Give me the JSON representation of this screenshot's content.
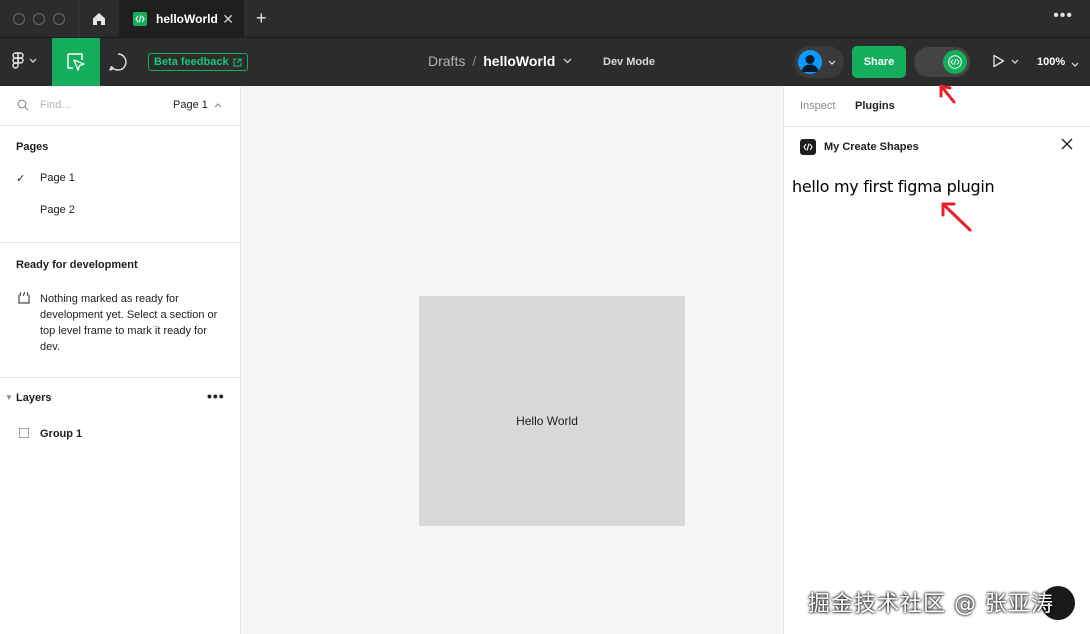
{
  "titlebar": {
    "tab_title": "helloWorld",
    "close_glyph": "✕",
    "new_tab_glyph": "+",
    "more_glyph": "•••"
  },
  "toolbar": {
    "beta_feedback": "Beta feedback",
    "breadcrumb_parent": "Drafts",
    "breadcrumb_sep": "/",
    "file_name": "helloWorld",
    "dev_mode_label": "Dev Mode",
    "share_label": "Share",
    "zoom": "100%",
    "caret": "⌄"
  },
  "left_panel": {
    "find_placeholder": "Find...",
    "current_page": "Page 1",
    "pages_title": "Pages",
    "pages": [
      {
        "label": "Page 1",
        "selected": true,
        "check": "✓"
      },
      {
        "label": "Page 2",
        "selected": false,
        "check": ""
      }
    ],
    "ready_title": "Ready for development",
    "ready_text": "Nothing marked as ready for development yet. Select a section or top level frame to mark it ready for dev.",
    "layers_title": "Layers",
    "layers_more": "•••",
    "layers": [
      {
        "label": "Group 1"
      }
    ]
  },
  "canvas": {
    "frame_text": "Hello World"
  },
  "right_panel": {
    "tabs": [
      {
        "label": "Inspect",
        "active": false
      },
      {
        "label": "Plugins",
        "active": true
      }
    ],
    "plugin_name": "My Create Shapes",
    "plugin_message": "hello my first figma plugin"
  },
  "watermark": "掘金技术社区 @ 张亚涛",
  "colors": {
    "accent_green": "#14ae5c",
    "toolbar_bg": "#2c2c2c",
    "annotation_red": "#e8202a"
  }
}
